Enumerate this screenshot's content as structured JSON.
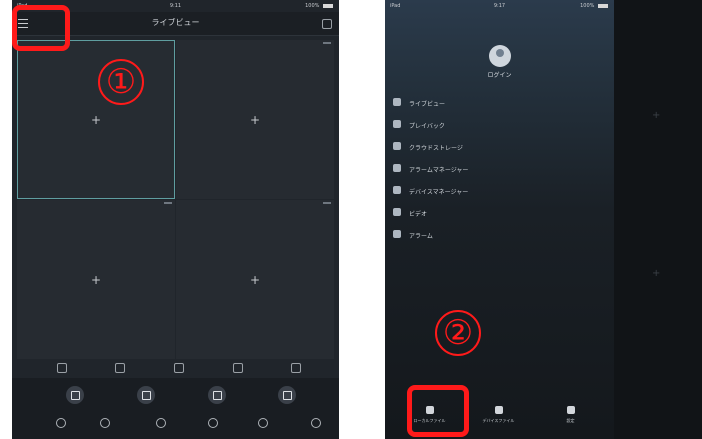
{
  "screen1": {
    "status": {
      "left": "iPad",
      "time": "9:11",
      "battery": "100%"
    },
    "nav": {
      "title": "ライブビュー"
    },
    "cells": [
      "+",
      "+",
      "+",
      "+"
    ],
    "marker_number": "①"
  },
  "screen2": {
    "status": {
      "left": "iPad",
      "time": "9:17",
      "battery": "100%"
    },
    "profile": {
      "name": "ログイン"
    },
    "menu": [
      {
        "label": "ライブビュー",
        "icon": "camera-icon"
      },
      {
        "label": "プレイバック",
        "icon": "playback-icon"
      },
      {
        "label": "クラウドストレージ",
        "icon": "cloud-icon"
      },
      {
        "label": "アラームマネージャー",
        "icon": "alarm-manager-icon"
      },
      {
        "label": "デバイスマネージャー",
        "icon": "device-manager-icon"
      },
      {
        "label": "ビデオ",
        "icon": "video-icon"
      },
      {
        "label": "アラーム",
        "icon": "alarm-icon"
      }
    ],
    "bottom": [
      {
        "label": "ローカルファイル"
      },
      {
        "label": "デバイスファイル"
      },
      {
        "label": "設定"
      }
    ],
    "marker_number": "②"
  }
}
